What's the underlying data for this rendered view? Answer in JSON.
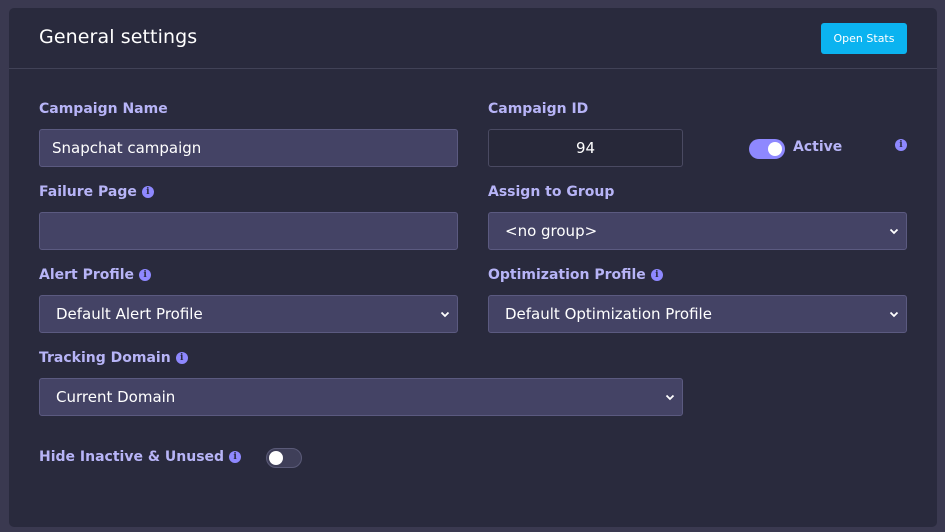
{
  "header": {
    "title": "General settings",
    "open_stats_label": "Open Stats"
  },
  "campaign_name": {
    "label": "Campaign Name",
    "value": "Snapchat campaign"
  },
  "campaign_id": {
    "label": "Campaign ID",
    "value": "94"
  },
  "active": {
    "label": "Active",
    "enabled": true
  },
  "failure_page": {
    "label": "Failure Page",
    "value": ""
  },
  "assign_group": {
    "label": "Assign to Group",
    "value": "<no group>"
  },
  "alert_profile": {
    "label": "Alert Profile",
    "value": "Default Alert Profile"
  },
  "optimization_profile": {
    "label": "Optimization Profile",
    "value": "Default Optimization Profile"
  },
  "tracking_domain": {
    "label": "Tracking Domain",
    "value": "Current Domain"
  },
  "hide_inactive": {
    "label": "Hide Inactive & Unused",
    "enabled": false
  },
  "info_glyph": "i",
  "colors": {
    "accent": "#8e88ff",
    "button": "#0bb3f0",
    "label": "#b7b4f7",
    "panel": "#292a3d"
  }
}
